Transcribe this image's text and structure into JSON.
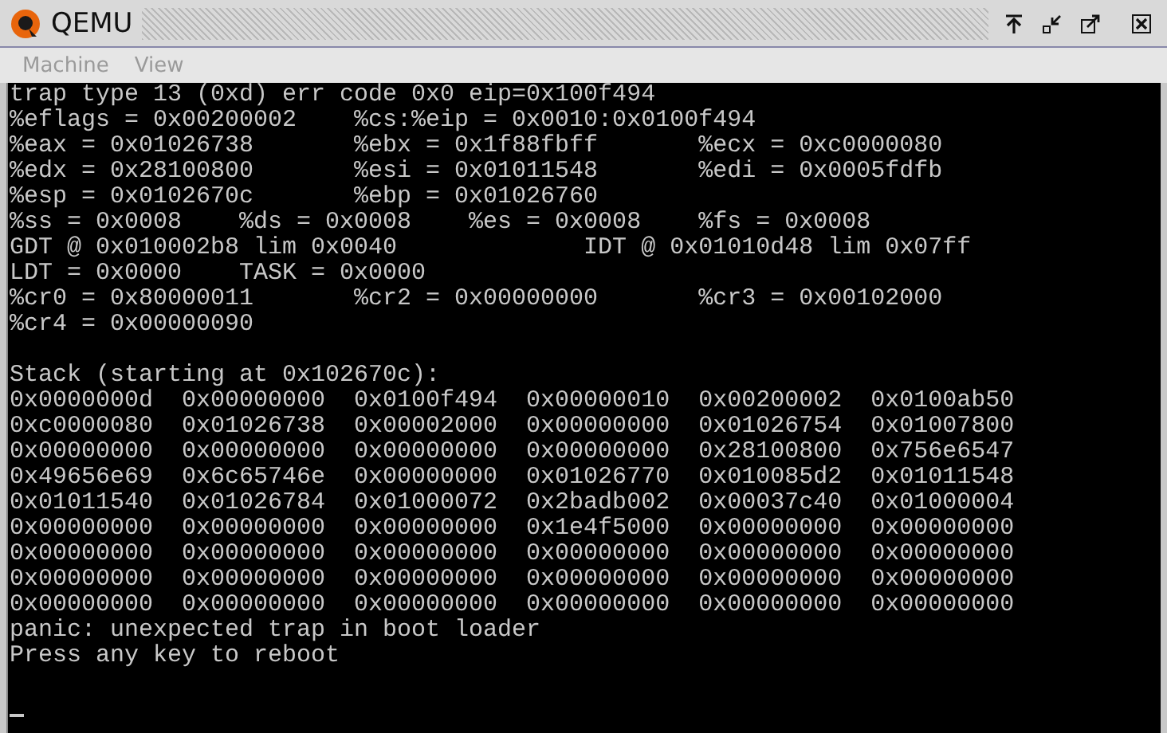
{
  "window": {
    "title": "QEMU"
  },
  "menu": [
    {
      "label": "Machine",
      "disabled": true
    },
    {
      "label": "View",
      "disabled": true
    }
  ],
  "console": {
    "register_lines": [
      "trap type 13 (0xd) err code 0x0 eip=0x100f494",
      "%eflags = 0x00200002    %cs:%eip = 0x0010:0x0100f494",
      "%eax = 0x01026738       %ebx = 0x1f88fbff       %ecx = 0xc0000080",
      "%edx = 0x28100800       %esi = 0x01011548       %edi = 0x0005fdfb",
      "%esp = 0x0102670c       %ebp = 0x01026760",
      "%ss = 0x0008    %ds = 0x0008    %es = 0x0008    %fs = 0x0008",
      "GDT @ 0x010002b8 lim 0x0040             IDT @ 0x01010d48 lim 0x07ff",
      "LDT = 0x0000    TASK = 0x0000",
      "%cr0 = 0x80000011       %cr2 = 0x00000000       %cr3 = 0x00102000",
      "%cr4 = 0x00000090"
    ],
    "stack_lines": [
      "Stack (starting at 0x102670c):",
      "0x0000000d  0x00000000  0x0100f494  0x00000010  0x00200002  0x0100ab50",
      "0xc0000080  0x01026738  0x00002000  0x00000000  0x01026754  0x01007800",
      "0x00000000  0x00000000  0x00000000  0x00000000  0x28100800  0x756e6547",
      "0x49656e69  0x6c65746e  0x00000000  0x01026770  0x010085d2  0x01011548",
      "0x01011540  0x01026784  0x01000072  0x2badb002  0x00037c40  0x01000004",
      "0x00000000  0x00000000  0x00000000  0x1e4f5000  0x00000000  0x00000000",
      "0x00000000  0x00000000  0x00000000  0x00000000  0x00000000  0x00000000",
      "0x00000000  0x00000000  0x00000000  0x00000000  0x00000000  0x00000000",
      "0x00000000  0x00000000  0x00000000  0x00000000  0x00000000  0x00000000",
      "panic: unexpected trap in boot loader",
      "Press any key to reboot"
    ]
  }
}
